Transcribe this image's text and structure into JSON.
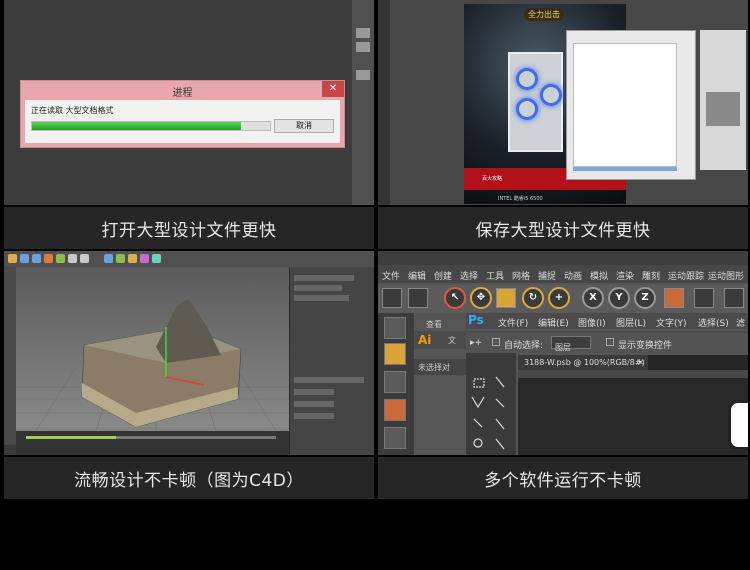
{
  "panels": [
    {
      "caption": "打开大型设计文件更快",
      "dialog": {
        "title": "进程",
        "close": "✕",
        "message": "正在读取 大型文档格式",
        "button": "取消",
        "progress": 0.88
      }
    },
    {
      "caption": "保存大型设计文件更快",
      "poster": {
        "logo": "全力出击",
        "brand_text": "百大攻略",
        "footer_text": "INTEL 酷睿i5 6500"
      }
    },
    {
      "caption": "流畅设计不卡顿（图为C4D）"
    },
    {
      "caption": "多个软件运行不卡顿",
      "menu": [
        "文件",
        "编辑",
        "创建",
        "选择",
        "工具",
        "网格",
        "捕捉",
        "动画",
        "模拟",
        "渲染",
        "雕刻",
        "运动跟踪",
        "运动图形"
      ],
      "ps": {
        "logo": "Ps",
        "menu": [
          "文件(F)",
          "编辑(E)",
          "图像(I)",
          "图层(L)",
          "文字(Y)",
          "选择(S)",
          "滤镜"
        ]
      },
      "ai": {
        "logo": "Ai",
        "menu": [
          "查看",
          "文"
        ]
      },
      "options": {
        "auto_select": "自动选择:",
        "layer": "图层",
        "show_transform": "显示变换控件"
      },
      "untitled": "未选择对",
      "doc_tab": "3188-W.psb @ 100%(RGB/8#)",
      "doc_close": "✕"
    }
  ]
}
